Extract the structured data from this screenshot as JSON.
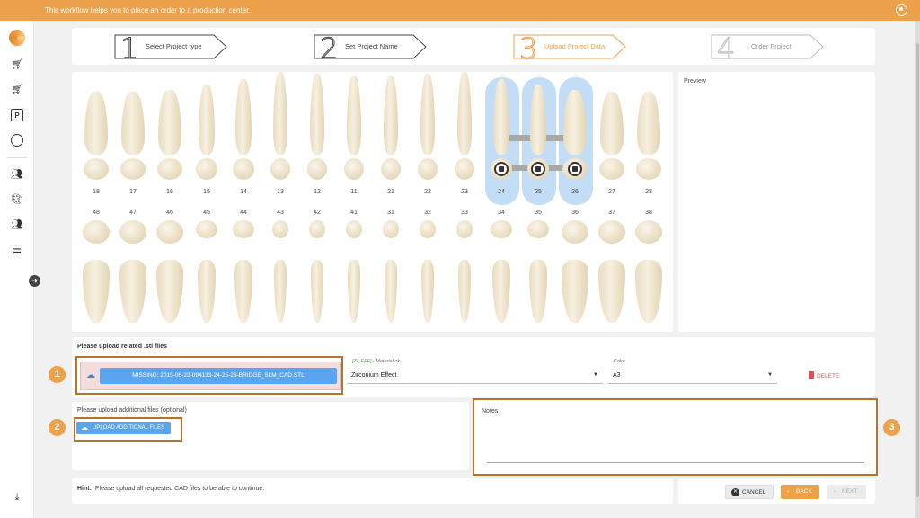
{
  "topbar": {
    "message": "This workflow helps you to place an order to a production center."
  },
  "steps": [
    {
      "num": "1",
      "label": "Select Project type",
      "state": "done"
    },
    {
      "num": "2",
      "label": "Set Project Name",
      "state": "done"
    },
    {
      "num": "3",
      "label": "Upload Project Data",
      "state": "active"
    },
    {
      "num": "4",
      "label": "Order Project",
      "state": "future"
    }
  ],
  "teeth": {
    "upper_numbers": [
      "18",
      "17",
      "16",
      "15",
      "14",
      "13",
      "12",
      "11",
      "21",
      "22",
      "23",
      "24",
      "25",
      "26",
      "27",
      "28"
    ],
    "lower_numbers": [
      "48",
      "47",
      "46",
      "45",
      "44",
      "43",
      "42",
      "41",
      "31",
      "32",
      "33",
      "34",
      "35",
      "36",
      "37",
      "38"
    ],
    "selected": [
      "24",
      "25",
      "26"
    ]
  },
  "preview": {
    "title": "Preview"
  },
  "upload": {
    "title": "Please upload related .stl files",
    "missing_button": "MISSING: 2015-06-22-094133-24-25-26-BRIDGE_SLM_CAD.STL",
    "material_code": "[ZI_EFF]",
    "material_status": " - Material ok",
    "material_value": "Zirconium Effect",
    "color_label": "Color",
    "color_value": "A3",
    "delete_label": "DELETE"
  },
  "additional": {
    "title": "Please upload additional files (optional)",
    "button": "UPLOAD ADDITIONAL FILES"
  },
  "notes": {
    "label": "Notes"
  },
  "hint": {
    "label": "Hint:",
    "text": "Please upload all requested CAD files to be able to continue."
  },
  "actions": {
    "cancel": "CANCEL",
    "back": "BACK",
    "next": "NEXT"
  },
  "badges": [
    "1",
    "2",
    "3"
  ],
  "colors": {
    "accent": "#eda14a",
    "button_blue": "#5aa5ee",
    "selection": "#c3ddf6",
    "delete": "#d9534f"
  }
}
